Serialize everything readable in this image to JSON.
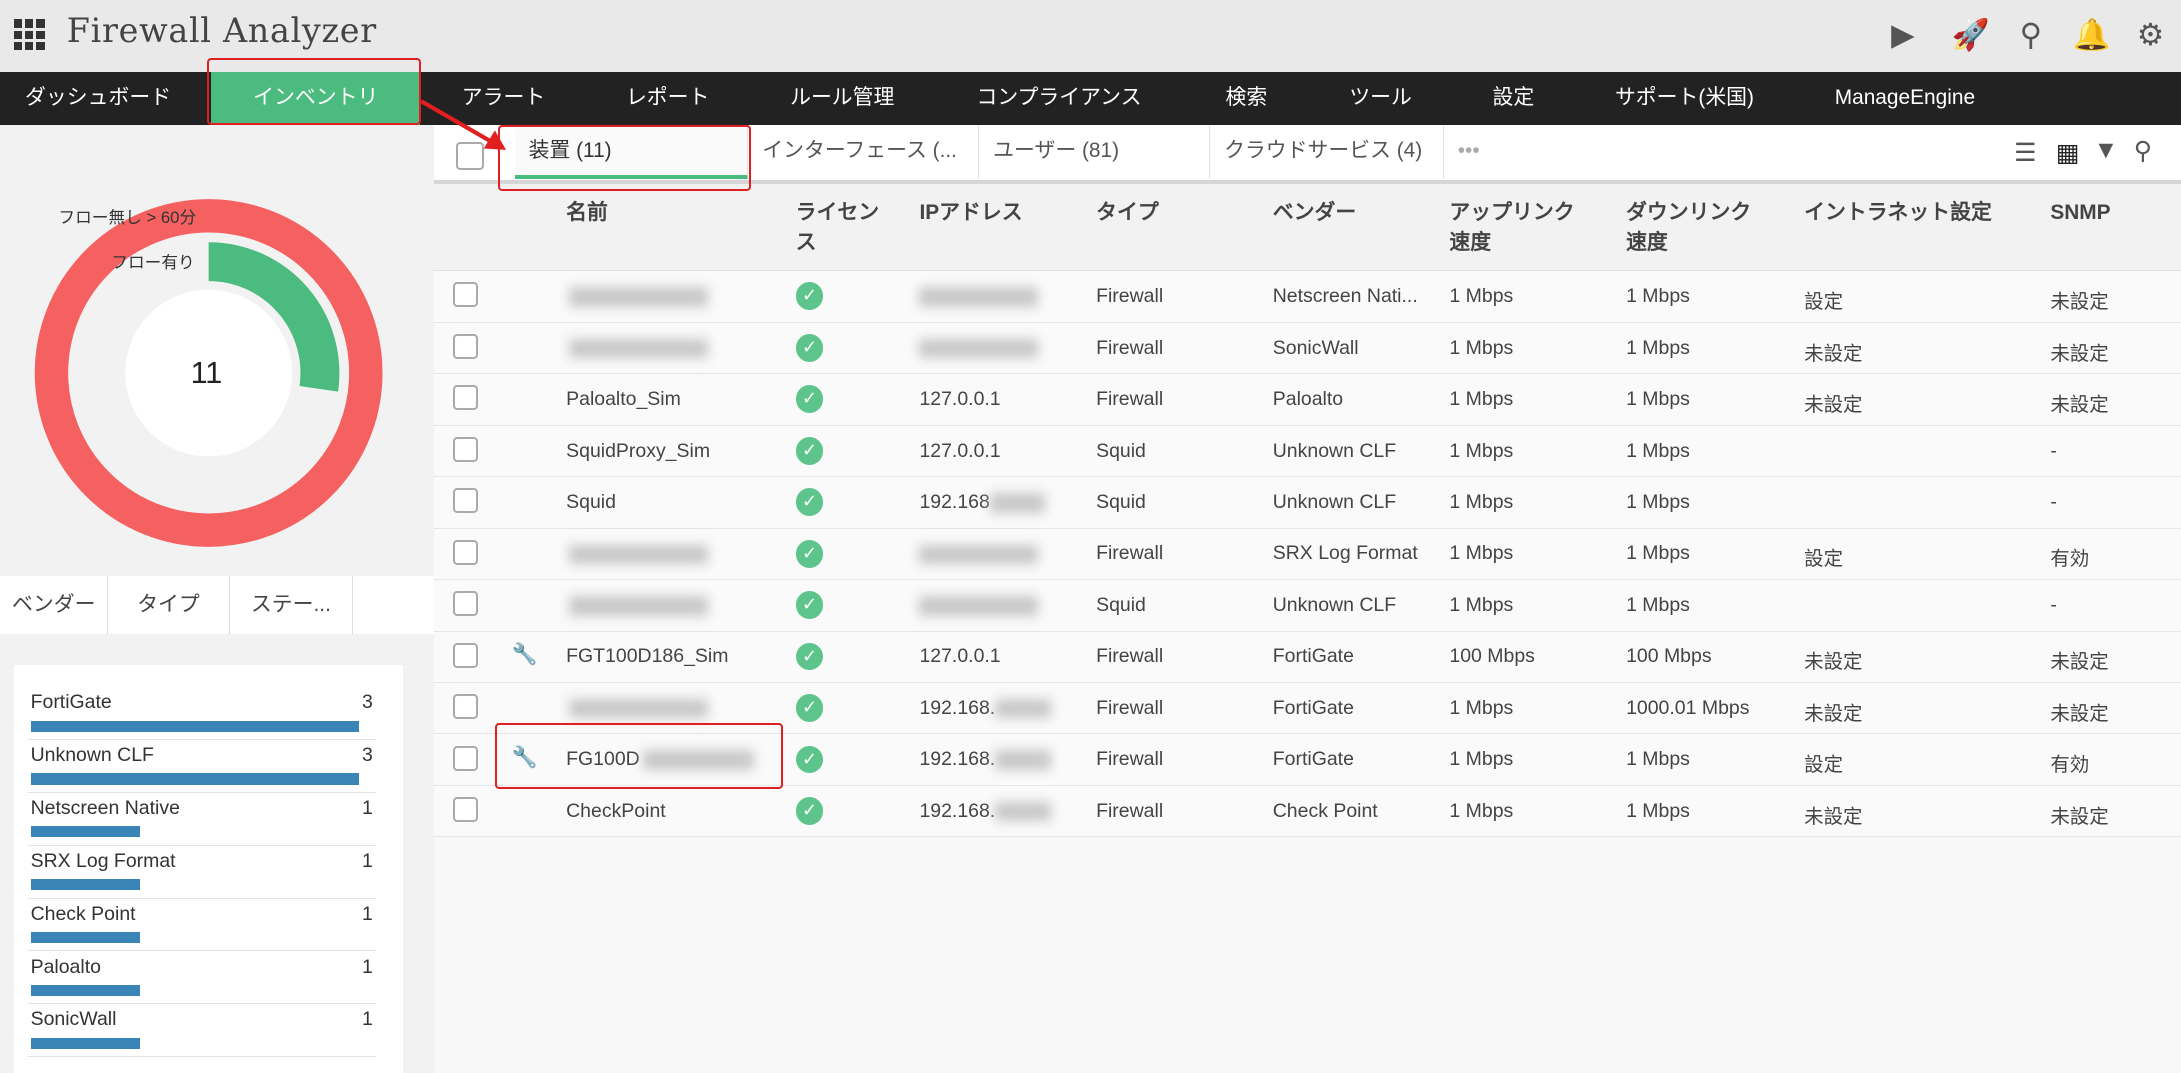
{
  "app": {
    "title": "Firewall Analyzer"
  },
  "header_icons": [
    "grid-icon",
    "presentation-icon",
    "rocket-icon",
    "search-icon",
    "bell-icon",
    "gear-icon"
  ],
  "nav": [
    "ダッシュボード",
    "インベントリ",
    "アラート",
    "レポート",
    "ルール管理",
    "コンプライアンス",
    "検索",
    "ツール",
    "設定",
    "サポート(米国)",
    "ManageEngine"
  ],
  "donut": {
    "total": "11",
    "legend": [
      "フロー無し > 60分",
      "フロー有り"
    ],
    "flow_absent": 11,
    "flow_present": 3,
    "colors": {
      "absent": "#f56060",
      "present": "#4cbb7f"
    }
  },
  "left_tabs": [
    "ベンダー",
    "タイプ",
    "ステー..."
  ],
  "vendor_list": [
    {
      "name": "FortiGate",
      "count": "3"
    },
    {
      "name": "Unknown CLF",
      "count": "3"
    },
    {
      "name": "Netscreen Native",
      "count": "1"
    },
    {
      "name": "SRX Log Format",
      "count": "1"
    },
    {
      "name": "Check Point",
      "count": "1"
    },
    {
      "name": "Paloalto",
      "count": "1"
    },
    {
      "name": "SonicWall",
      "count": "1"
    }
  ],
  "tabs": [
    "装置 (11)",
    "インターフェース (...",
    "ユーザー (81)",
    "クラウドサービス (4)",
    "•••"
  ],
  "columns": [
    "名前",
    "ライセンス",
    "IPアドレス",
    "タイプ",
    "ベンダー",
    "アップリンク速度",
    "ダウンリンク速度",
    "イントラネット設定",
    "SNMP"
  ],
  "rows": [
    {
      "name": "",
      "ip": "",
      "type": "Firewall",
      "vendor": "Netscreen Nati...",
      "up": "1 Mbps",
      "down": "1 Mbps",
      "intranet": "設定",
      "snmp": "未設定",
      "wrench": false
    },
    {
      "name": "",
      "ip": "",
      "type": "Firewall",
      "vendor": "SonicWall",
      "up": "1 Mbps",
      "down": "1 Mbps",
      "intranet": "未設定",
      "snmp": "未設定",
      "wrench": false
    },
    {
      "name": "Paloalto_Sim",
      "ip": "127.0.0.1",
      "type": "Firewall",
      "vendor": "Paloalto",
      "up": "1 Mbps",
      "down": "1 Mbps",
      "intranet": "未設定",
      "snmp": "未設定",
      "wrench": false
    },
    {
      "name": "SquidProxy_Sim",
      "ip": "127.0.0.1",
      "type": "Squid",
      "vendor": "Unknown CLF",
      "up": "1 Mbps",
      "down": "1 Mbps",
      "intranet": "",
      "snmp": "-",
      "wrench": false
    },
    {
      "name": "Squid",
      "ip": "192.168",
      "type": "Squid",
      "vendor": "Unknown CLF",
      "up": "1 Mbps",
      "down": "1 Mbps",
      "intranet": "",
      "snmp": "-",
      "wrench": false
    },
    {
      "name": "",
      "ip": "",
      "type": "Firewall",
      "vendor": "SRX Log Format",
      "up": "1 Mbps",
      "down": "1 Mbps",
      "intranet": "設定",
      "snmp": "有効",
      "wrench": false
    },
    {
      "name": "",
      "ip": "",
      "type": "Squid",
      "vendor": "Unknown CLF",
      "up": "1 Mbps",
      "down": "1 Mbps",
      "intranet": "",
      "snmp": "-",
      "wrench": false
    },
    {
      "name": "FGT100D186_Sim",
      "ip": "127.0.0.1",
      "type": "Firewall",
      "vendor": "FortiGate",
      "up": "100 Mbps",
      "down": "100 Mbps",
      "intranet": "未設定",
      "snmp": "未設定",
      "wrench": true
    },
    {
      "name": "",
      "ip": "192.168.",
      "type": "Firewall",
      "vendor": "FortiGate",
      "up": "1 Mbps",
      "down": "1000.01 Mbps",
      "intranet": "未設定",
      "snmp": "未設定",
      "wrench": false
    },
    {
      "name": "FG100D",
      "ip": "192.168.",
      "type": "Firewall",
      "vendor": "FortiGate",
      "up": "1 Mbps",
      "down": "1 Mbps",
      "intranet": "設定",
      "snmp": "有効",
      "wrench": true
    },
    {
      "name": "CheckPoint",
      "ip": "192.168.",
      "type": "Firewall",
      "vendor": "Check Point",
      "up": "1 Mbps",
      "down": "1 Mbps",
      "intranet": "未設定",
      "snmp": "未設定",
      "wrench": false
    }
  ]
}
